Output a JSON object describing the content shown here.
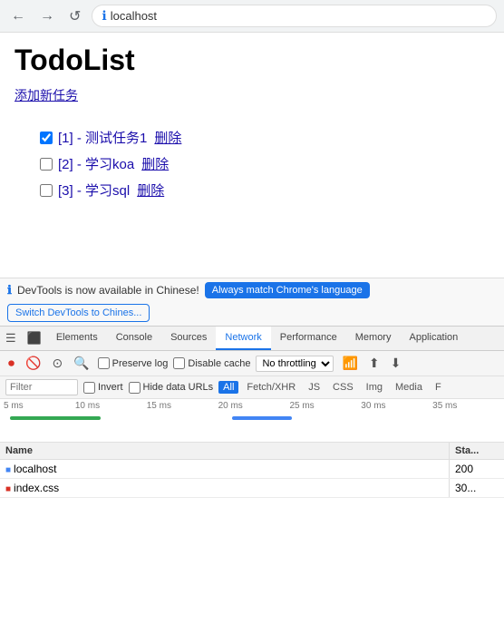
{
  "browser": {
    "url": "localhost",
    "back_btn": "←",
    "forward_btn": "→",
    "reload_btn": "↺"
  },
  "page": {
    "title": "TodoList",
    "add_task_link": "添加新任务",
    "tasks": [
      {
        "id": 1,
        "label": "[1] - 测试任务1",
        "delete": "删除",
        "checked": true
      },
      {
        "id": 2,
        "label": "[2] - 学习koa",
        "delete": "删除",
        "checked": false
      },
      {
        "id": 3,
        "label": "[3] - 学习sql",
        "delete": "删除",
        "checked": false
      }
    ]
  },
  "devtools_notify": {
    "info_icon": "ℹ",
    "text": "DevTools is now available in Chinese!",
    "btn_match": "Always match Chrome's language",
    "btn_switch": "Switch DevTools to Chines..."
  },
  "devtools": {
    "tabs": [
      {
        "label": "☰",
        "icon": true
      },
      {
        "label": "⬛",
        "icon": true
      },
      {
        "label": "Elements"
      },
      {
        "label": "Console"
      },
      {
        "label": "Sources"
      },
      {
        "label": "Network",
        "active": true
      },
      {
        "label": "Performance"
      },
      {
        "label": "Memory"
      },
      {
        "label": "Application"
      }
    ],
    "toolbar": {
      "record_icon": "⏺",
      "clear_icon": "🚫",
      "filter_icon": "⋮",
      "search_icon": "🔍",
      "preserve_log": "Preserve log",
      "disable_cache": "Disable cache",
      "throttle": "No throttling",
      "wifi_icon": "📶",
      "upload_icon": "⬆",
      "download_icon": "⬇"
    },
    "filter_row": {
      "invert": "Invert",
      "hide_data_urls": "Hide data URLs",
      "tabs": [
        "All",
        "Fetch/XHR",
        "JS",
        "CSS",
        "Img",
        "Media",
        "F"
      ],
      "active_tab": "All",
      "placeholder": "Filter"
    },
    "timeline": {
      "labels": [
        "5 ms",
        "10 ms",
        "15 ms",
        "20 ms",
        "25 ms",
        "30 ms",
        "35 ms"
      ],
      "bars": [
        {
          "left_pct": 2,
          "width_pct": 18,
          "color": "bar-green"
        },
        {
          "left_pct": 46,
          "width_pct": 12,
          "color": "bar-blue"
        }
      ]
    },
    "table": {
      "headers": [
        "Name",
        "Sta..."
      ],
      "rows": [
        {
          "icon_type": "blue",
          "name": "localhost",
          "status": "200"
        },
        {
          "icon_type": "red",
          "name": "index.css",
          "status": "30..."
        }
      ]
    }
  }
}
